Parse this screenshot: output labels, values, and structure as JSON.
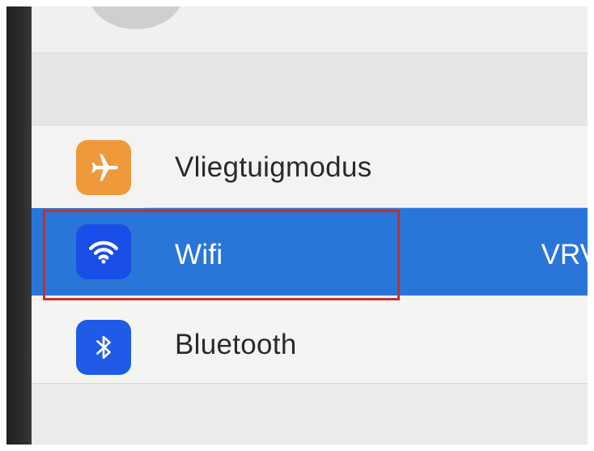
{
  "settings": {
    "items": [
      {
        "label": "Vliegtuigmodus",
        "icon": "airplane-icon",
        "icon_color": "#ef9a3a"
      },
      {
        "label": "Wifi",
        "value": "VRV",
        "icon": "wifi-icon",
        "icon_color": "#1a4ee8",
        "selected": true
      },
      {
        "label": "Bluetooth",
        "icon": "bluetooth-icon",
        "icon_color": "#1f5be6"
      }
    ]
  },
  "highlight": {
    "color": "#c0322f",
    "target": "Wifi"
  },
  "colors": {
    "selected_row": "#2a76d8"
  }
}
